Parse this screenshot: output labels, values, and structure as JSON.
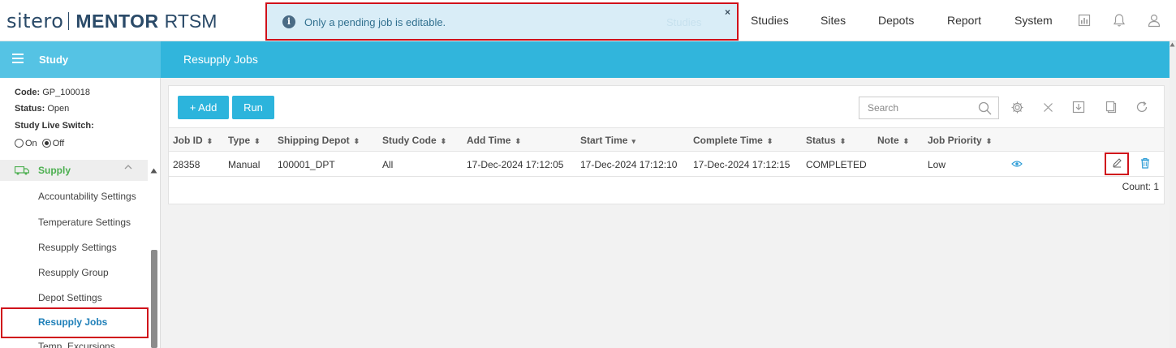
{
  "brand": {
    "sitero": "sitero",
    "mentor": "MENTOR",
    "rtsm": "RTSM"
  },
  "topnav": {
    "items": [
      "Studies",
      "Sites",
      "Depots",
      "Report",
      "System"
    ]
  },
  "toast": {
    "message": "Only a pending job is editable.",
    "ghost_text": "Studies",
    "close": "×",
    "info_glyph": "i"
  },
  "band": {
    "study_label": "Study",
    "page_title": "Resupply Jobs"
  },
  "sidebar": {
    "code_label": "Code:",
    "code_value": "GP_100018",
    "status_label": "Status:",
    "status_value": "Open",
    "live_switch_label": "Study Live Switch:",
    "radio_on": "On",
    "radio_off": "Off",
    "radio_selected": "Off",
    "section": "Supply",
    "items": [
      "Accountability Settings",
      "Temperature Settings",
      "Resupply Settings",
      "Resupply Group",
      "Depot Settings",
      "Resupply Jobs",
      "Temp. Excursions"
    ],
    "active_item": "Resupply Jobs"
  },
  "toolbar": {
    "add_label": "+ Add",
    "run_label": "Run",
    "search_placeholder": "Search"
  },
  "table": {
    "columns": [
      "Job ID",
      "Type",
      "Shipping Depot",
      "Study Code",
      "Add Time",
      "Start Time",
      "Complete Time",
      "Status",
      "Note",
      "Job Priority"
    ],
    "rows": [
      {
        "job_id": "28358",
        "type": "Manual",
        "shipping_depot": "100001_DPT",
        "study_code": "All",
        "add_time": "17-Dec-2024 17:12:05",
        "start_time": "17-Dec-2024 17:12:10",
        "complete_time": "17-Dec-2024 17:12:15",
        "status": "COMPLETED",
        "note": "",
        "job_priority": "Low"
      }
    ],
    "count_text": "Count: 1"
  },
  "colors": {
    "accent": "#31b5dc",
    "highlight": "#d0111b",
    "supply_green": "#4caf50",
    "active_link": "#1e7fb8"
  }
}
